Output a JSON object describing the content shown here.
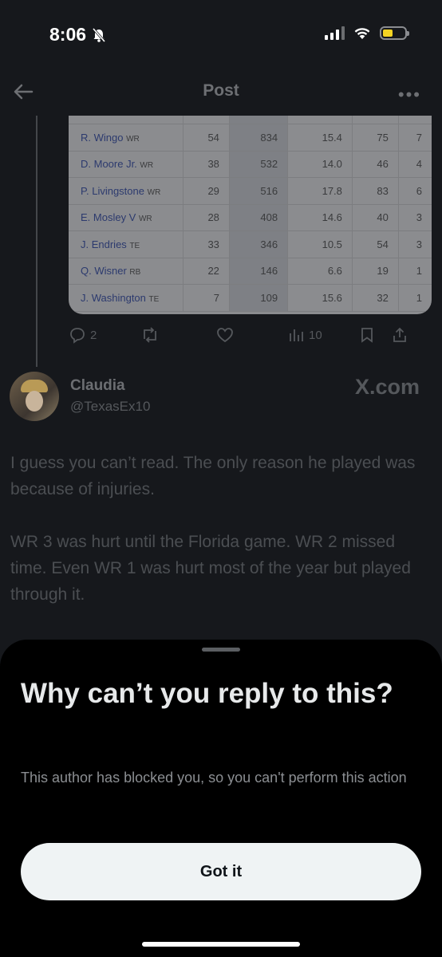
{
  "status_bar": {
    "time": "8:06"
  },
  "nav": {
    "title": "Post"
  },
  "table": {
    "rows": [
      {
        "name": "R. Wingo",
        "pos": "WR",
        "rec": "54",
        "yds": "834",
        "avg": "15.4",
        "long": "75",
        "td": "7"
      },
      {
        "name": "D. Moore Jr.",
        "pos": "WR",
        "rec": "38",
        "yds": "532",
        "avg": "14.0",
        "long": "46",
        "td": "4"
      },
      {
        "name": "P. Livingstone",
        "pos": "WR",
        "rec": "29",
        "yds": "516",
        "avg": "17.8",
        "long": "83",
        "td": "6"
      },
      {
        "name": "E. Mosley V",
        "pos": "WR",
        "rec": "28",
        "yds": "408",
        "avg": "14.6",
        "long": "40",
        "td": "3"
      },
      {
        "name": "J. Endries",
        "pos": "TE",
        "rec": "33",
        "yds": "346",
        "avg": "10.5",
        "long": "54",
        "td": "3"
      },
      {
        "name": "Q. Wisner",
        "pos": "RB",
        "rec": "22",
        "yds": "146",
        "avg": "6.6",
        "long": "19",
        "td": "1"
      },
      {
        "name": "J. Washington",
        "pos": "TE",
        "rec": "7",
        "yds": "109",
        "avg": "15.6",
        "long": "32",
        "td": "1"
      }
    ]
  },
  "actions": {
    "replies": "2",
    "views": "10"
  },
  "author": {
    "name": "Claudia",
    "handle": "@TexasEx10",
    "watermark": "X.com"
  },
  "post": {
    "paragraph1": "I guess you can’t read. The only reason he played was because of injuries.",
    "paragraph2": "WR 3 was hurt until the Florida game. WR 2 missed time. Even WR 1 was hurt most of the year but played through it."
  },
  "sheet": {
    "title": "Why can’t you reply to this?",
    "body": "This author has blocked you, so you can't perform this action",
    "button_label": "Got it"
  },
  "colors": {
    "sheet_bg": "#000000",
    "button_bg": "#eff3f4",
    "battery": "#f4d423"
  }
}
